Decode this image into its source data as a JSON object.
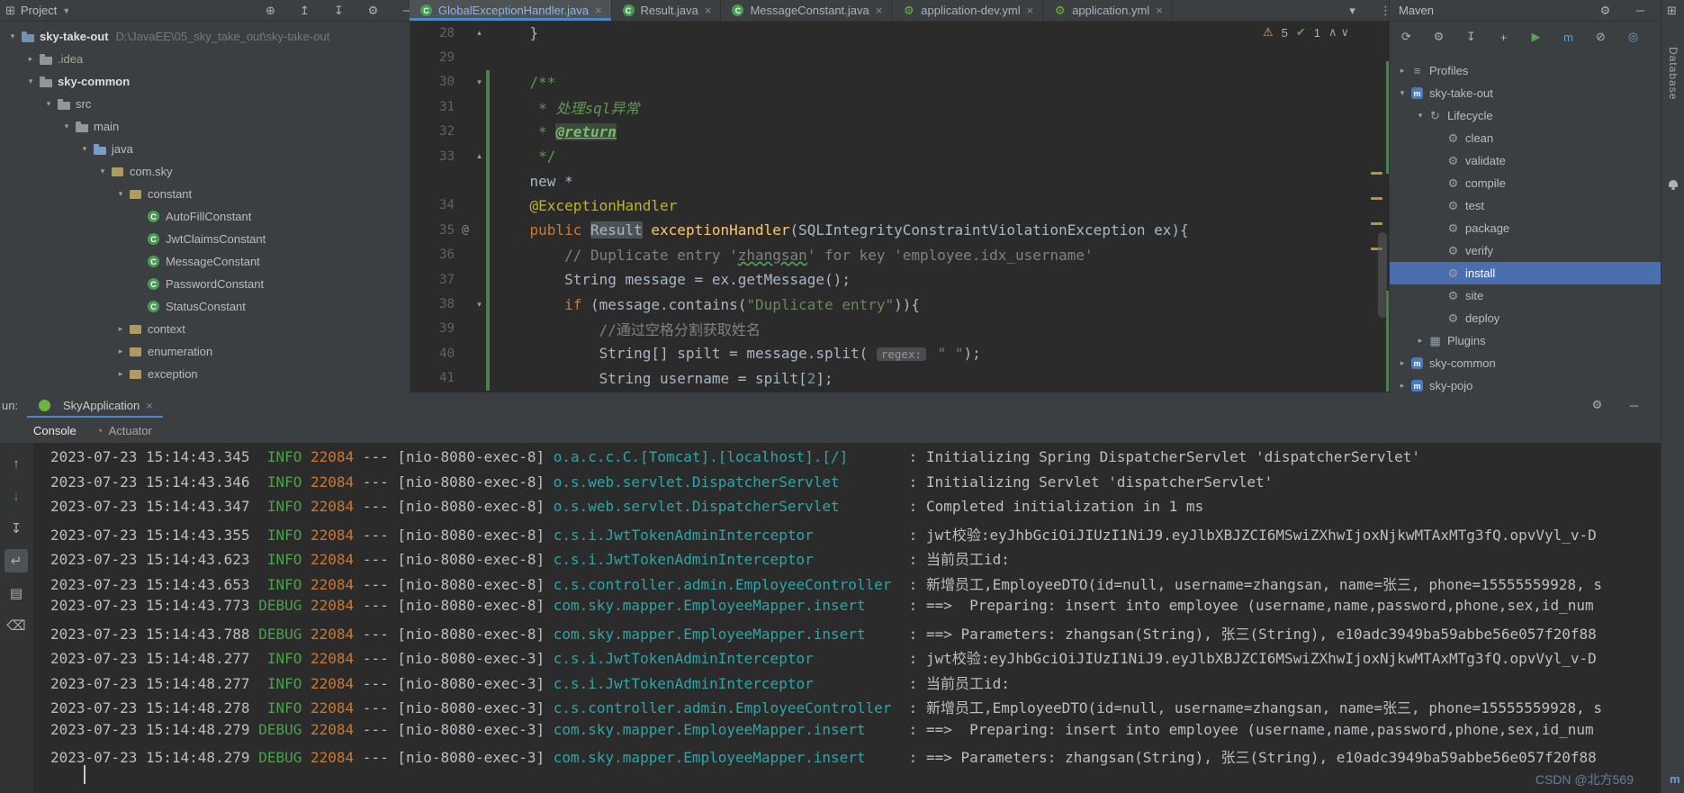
{
  "topbar": {
    "project_label": "Project",
    "project_icons": [
      "web-icon",
      "scroll-up-icon",
      "scroll-down-icon",
      "settings-icon",
      "hide-icon"
    ],
    "tab_overflow_icons": [
      "chevron-down-icon",
      "more-vertical-icon"
    ]
  },
  "editor_tabs": [
    {
      "label": "GlobalExceptionHandler.java",
      "icon": "java-class-icon",
      "active": true
    },
    {
      "label": "Result.java",
      "icon": "java-class-icon",
      "active": false
    },
    {
      "label": "MessageConstant.java",
      "icon": "java-class-icon",
      "active": false
    },
    {
      "label": "application-dev.yml",
      "icon": "spring-config-icon",
      "active": false
    },
    {
      "label": "application.yml",
      "icon": "spring-config-icon",
      "active": false
    }
  ],
  "project_tree": [
    {
      "label": "sky-take-out",
      "path": "D:\\JavaEE\\05_sky_take_out\\sky-take-out",
      "icon": "project-folder-icon",
      "indent": 0,
      "chevron": "down",
      "bold": true
    },
    {
      "label": ".idea",
      "icon": "folder-icon",
      "indent": 1,
      "chevron": "right",
      "dim": true
    },
    {
      "label": "sky-common",
      "icon": "folder-icon",
      "indent": 1,
      "chevron": "down",
      "bold": true
    },
    {
      "label": "src",
      "icon": "folder-icon",
      "indent": 2,
      "chevron": "down"
    },
    {
      "label": "main",
      "icon": "folder-icon",
      "indent": 3,
      "chevron": "down"
    },
    {
      "label": "java",
      "icon": "source-folder-icon",
      "indent": 4,
      "chevron": "down"
    },
    {
      "label": "com.sky",
      "icon": "package-icon",
      "indent": 5,
      "chevron": "down"
    },
    {
      "label": "constant",
      "icon": "package-icon",
      "indent": 6,
      "chevron": "down"
    },
    {
      "label": "AutoFillConstant",
      "icon": "class-icon",
      "indent": 7,
      "chevron": "none"
    },
    {
      "label": "JwtClaimsConstant",
      "icon": "class-icon",
      "indent": 7,
      "chevron": "none"
    },
    {
      "label": "MessageConstant",
      "icon": "class-icon",
      "indent": 7,
      "chevron": "none"
    },
    {
      "label": "PasswordConstant",
      "icon": "class-icon",
      "indent": 7,
      "chevron": "none"
    },
    {
      "label": "StatusConstant",
      "icon": "class-icon",
      "indent": 7,
      "chevron": "none"
    },
    {
      "label": "context",
      "icon": "package-icon",
      "indent": 6,
      "chevron": "right"
    },
    {
      "label": "enumeration",
      "icon": "package-icon",
      "indent": 6,
      "chevron": "right"
    },
    {
      "label": "exception",
      "icon": "package-icon",
      "indent": 6,
      "chevron": "right"
    }
  ],
  "editor": {
    "inspections": {
      "warning_count": "5",
      "ok_count": "1"
    },
    "lines": [
      {
        "no": "28",
        "fold": "up",
        "segs": [
          {
            "t": "    }",
            "s": "def"
          }
        ]
      },
      {
        "no": "29",
        "segs": []
      },
      {
        "no": "30",
        "fold": "down",
        "changed": true,
        "segs": [
          {
            "t": "    /**",
            "s": "doc"
          }
        ]
      },
      {
        "no": "31",
        "changed": true,
        "segs": [
          {
            "t": "     * ",
            "s": "doc"
          },
          {
            "t": "处理sql异常",
            "s": "doci"
          }
        ]
      },
      {
        "no": "32",
        "changed": true,
        "segs": [
          {
            "t": "     * ",
            "s": "doc"
          },
          {
            "t": "@return",
            "s": "doctag"
          }
        ]
      },
      {
        "no": "33",
        "fold": "up",
        "changed": true,
        "segs": [
          {
            "t": "     */",
            "s": "doc"
          }
        ]
      },
      {
        "no": null,
        "changed": true,
        "segs": [
          {
            "t": "    new *",
            "s": "def"
          }
        ]
      },
      {
        "no": "34",
        "changed": true,
        "segs": [
          {
            "t": "    ",
            "s": "def"
          },
          {
            "t": "@ExceptionHandler",
            "s": "ann"
          }
        ]
      },
      {
        "no": "35",
        "gutter": "@",
        "changed": true,
        "segs": [
          {
            "t": "    ",
            "s": "def"
          },
          {
            "t": "public ",
            "s": "kw"
          },
          {
            "t": "Result",
            "s": "hl"
          },
          {
            "t": " ",
            "s": "def"
          },
          {
            "t": "exceptionHandler",
            "s": "method"
          },
          {
            "t": "(SQLIntegrityConstraintViolationException ex){",
            "s": "def"
          }
        ]
      },
      {
        "no": "36",
        "changed": true,
        "segs": [
          {
            "t": "        ",
            "s": "def"
          },
          {
            "t": "// Duplicate entry '",
            "s": "com"
          },
          {
            "t": "zhangsan",
            "s": "typo"
          },
          {
            "t": "' for key 'employee.idx_username'",
            "s": "com"
          }
        ]
      },
      {
        "no": "37",
        "changed": true,
        "segs": [
          {
            "t": "        String message = ex.getMessage();",
            "s": "def"
          }
        ]
      },
      {
        "no": "38",
        "fold": "down",
        "changed": true,
        "segs": [
          {
            "t": "        ",
            "s": "def"
          },
          {
            "t": "if",
            "s": "kw"
          },
          {
            "t": " (message.contains(",
            "s": "def"
          },
          {
            "t": "\"Duplicate entry\"",
            "s": "str"
          },
          {
            "t": ")){",
            "s": "def"
          }
        ]
      },
      {
        "no": "39",
        "changed": true,
        "segs": [
          {
            "t": "            ",
            "s": "def"
          },
          {
            "t": "//通过空格分割获取姓名",
            "s": "com"
          }
        ]
      },
      {
        "no": "40",
        "changed": true,
        "segs": [
          {
            "t": "            String[] spilt = message.split( ",
            "s": "def"
          },
          {
            "t": "regex:",
            "s": "hint"
          },
          {
            "t": " ",
            "s": "def"
          },
          {
            "t": "\" \"",
            "s": "str"
          },
          {
            "t": ");",
            "s": "def"
          }
        ]
      },
      {
        "no": "41",
        "changed": true,
        "segs": [
          {
            "t": "            String username = spilt[",
            "s": "def"
          },
          {
            "t": "2",
            "s": "num"
          },
          {
            "t": "];",
            "s": "def"
          }
        ]
      }
    ]
  },
  "maven": {
    "title": "Maven",
    "header_icons": [
      "settings-icon",
      "hide-icon"
    ],
    "toolbar_icons": [
      "refresh-icon",
      "generate-sources-icon",
      "download-sources-icon",
      "add-icon",
      "run-icon",
      "execute-goal-icon",
      "skip-tests-icon",
      "offline-icon",
      "more-icon"
    ],
    "items": [
      {
        "label": "Profiles",
        "icon": "profiles-icon",
        "indent": 0,
        "chevron": "right"
      },
      {
        "label": "sky-take-out",
        "icon": "maven-module-icon",
        "indent": 0,
        "chevron": "down"
      },
      {
        "label": "Lifecycle",
        "icon": "lifecycle-icon",
        "indent": 1,
        "chevron": "down"
      },
      {
        "label": "clean",
        "icon": "goal-icon",
        "indent": 2,
        "chevron": "none"
      },
      {
        "label": "validate",
        "icon": "goal-icon",
        "indent": 2,
        "chevron": "none"
      },
      {
        "label": "compile",
        "icon": "goal-icon",
        "indent": 2,
        "chevron": "none"
      },
      {
        "label": "test",
        "icon": "goal-icon",
        "indent": 2,
        "chevron": "none"
      },
      {
        "label": "package",
        "icon": "goal-icon",
        "indent": 2,
        "chevron": "none"
      },
      {
        "label": "verify",
        "icon": "goal-icon",
        "indent": 2,
        "chevron": "none"
      },
      {
        "label": "install",
        "icon": "goal-icon",
        "indent": 2,
        "chevron": "none",
        "selected": true
      },
      {
        "label": "site",
        "icon": "goal-icon",
        "indent": 2,
        "chevron": "none"
      },
      {
        "label": "deploy",
        "icon": "goal-icon",
        "indent": 2,
        "chevron": "none"
      },
      {
        "label": "Plugins",
        "icon": "plugins-icon",
        "indent": 1,
        "chevron": "right"
      },
      {
        "label": "sky-common",
        "icon": "maven-module-icon",
        "indent": 0,
        "chevron": "right"
      },
      {
        "label": "sky-pojo",
        "icon": "maven-module-icon",
        "indent": 0,
        "chevron": "right"
      }
    ]
  },
  "right_strip": {
    "vertical_label": "Database",
    "bottom_label": "m"
  },
  "run_panel": {
    "clipped_run_label": "un:",
    "tab_label": "SkyApplication",
    "subtabs": [
      {
        "label": "Console",
        "active": true
      },
      {
        "label": "Actuator",
        "icon": "actuator-icon",
        "active": false
      }
    ],
    "gutter_icons": [
      "up-icon",
      "down-icon",
      "scroll-down-icon",
      "soft-wrap-icon",
      "print-icon",
      "clear-icon"
    ],
    "watermark": "CSDN @北方569",
    "log_format": {
      "logger_pad": 40
    },
    "log": [
      {
        "ts": "2023-07-23 15:14:43.345",
        "level": "INFO",
        "pid": "22084",
        "thread": "nio-8080-exec-8",
        "logger": "o.a.c.c.C.[Tomcat].[localhost].[/]",
        "msg": "Initializing Spring DispatcherServlet 'dispatcherServlet'"
      },
      {
        "ts": "2023-07-23 15:14:43.346",
        "level": "INFO",
        "pid": "22084",
        "thread": "nio-8080-exec-8",
        "logger": "o.s.web.servlet.DispatcherServlet",
        "msg": "Initializing Servlet 'dispatcherServlet'"
      },
      {
        "ts": "2023-07-23 15:14:43.347",
        "level": "INFO",
        "pid": "22084",
        "thread": "nio-8080-exec-8",
        "logger": "o.s.web.servlet.DispatcherServlet",
        "msg": "Completed initialization in 1 ms"
      },
      {
        "ts": "2023-07-23 15:14:43.355",
        "level": "INFO",
        "pid": "22084",
        "thread": "nio-8080-exec-8",
        "logger": "c.s.i.JwtTokenAdminInterceptor",
        "msg": "jwt校验:eyJhbGciOiJIUzI1NiJ9.eyJlbXBJZCI6MSwiZXhwIjoxNjkwMTAxMTg3fQ.opvVyl_v-D"
      },
      {
        "ts": "2023-07-23 15:14:43.623",
        "level": "INFO",
        "pid": "22084",
        "thread": "nio-8080-exec-8",
        "logger": "c.s.i.JwtTokenAdminInterceptor",
        "msg": "当前员工id:"
      },
      {
        "ts": "2023-07-23 15:14:43.653",
        "level": "INFO",
        "pid": "22084",
        "thread": "nio-8080-exec-8",
        "logger": "c.s.controller.admin.EmployeeController",
        "msg": "新增员工,EmployeeDTO(id=null, username=zhangsan, name=张三, phone=15555559928, s"
      },
      {
        "ts": "2023-07-23 15:14:43.773",
        "level": "DEBUG",
        "pid": "22084",
        "thread": "nio-8080-exec-8",
        "logger": "com.sky.mapper.EmployeeMapper.insert",
        "msg": "==>  Preparing: insert into employee (username,name,password,phone,sex,id_num"
      },
      {
        "ts": "2023-07-23 15:14:43.788",
        "level": "DEBUG",
        "pid": "22084",
        "thread": "nio-8080-exec-8",
        "logger": "com.sky.mapper.EmployeeMapper.insert",
        "msg": "==> Parameters: zhangsan(String), 张三(String), e10adc3949ba59abbe56e057f20f88"
      },
      {
        "ts": "2023-07-23 15:14:48.277",
        "level": "INFO",
        "pid": "22084",
        "thread": "nio-8080-exec-3",
        "logger": "c.s.i.JwtTokenAdminInterceptor",
        "msg": "jwt校验:eyJhbGciOiJIUzI1NiJ9.eyJlbXBJZCI6MSwiZXhwIjoxNjkwMTAxMTg3fQ.opvVyl_v-D"
      },
      {
        "ts": "2023-07-23 15:14:48.277",
        "level": "INFO",
        "pid": "22084",
        "thread": "nio-8080-exec-3",
        "logger": "c.s.i.JwtTokenAdminInterceptor",
        "msg": "当前员工id:"
      },
      {
        "ts": "2023-07-23 15:14:48.278",
        "level": "INFO",
        "pid": "22084",
        "thread": "nio-8080-exec-3",
        "logger": "c.s.controller.admin.EmployeeController",
        "msg": "新增员工,EmployeeDTO(id=null, username=zhangsan, name=张三, phone=15555559928, s"
      },
      {
        "ts": "2023-07-23 15:14:48.279",
        "level": "DEBUG",
        "pid": "22084",
        "thread": "nio-8080-exec-3",
        "logger": "com.sky.mapper.EmployeeMapper.insert",
        "msg": "==>  Preparing: insert into employee (username,name,password,phone,sex,id_num"
      },
      {
        "ts": "2023-07-23 15:14:48.279",
        "level": "DEBUG",
        "pid": "22084",
        "thread": "nio-8080-exec-3",
        "logger": "com.sky.mapper.EmployeeMapper.insert",
        "msg": "==> Parameters: zhangsan(String), 张三(String), e10adc3949ba59abbe56e057f20f88"
      }
    ]
  }
}
